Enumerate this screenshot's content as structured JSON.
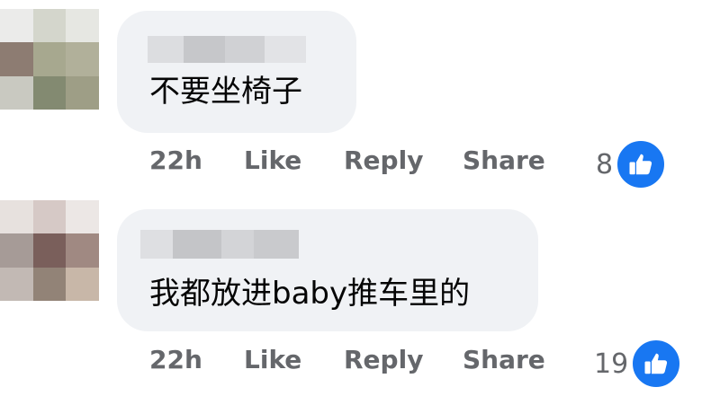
{
  "comments": [
    {
      "text": "不要坐椅子",
      "time": "22h",
      "like_label": "Like",
      "reply_label": "Reply",
      "share_label": "Share",
      "reaction_count": "8",
      "reaction_icon": "thumbs-up-icon"
    },
    {
      "text": "我都放进baby推车里的",
      "time": "22h",
      "like_label": "Like",
      "reply_label": "Reply",
      "share_label": "Share",
      "reaction_count": "19",
      "reaction_icon": "thumbs-up-icon"
    }
  ],
  "colors": {
    "bubble": "#f0f2f5",
    "meta_text": "#65676b",
    "like_blue": "#1877f2"
  }
}
